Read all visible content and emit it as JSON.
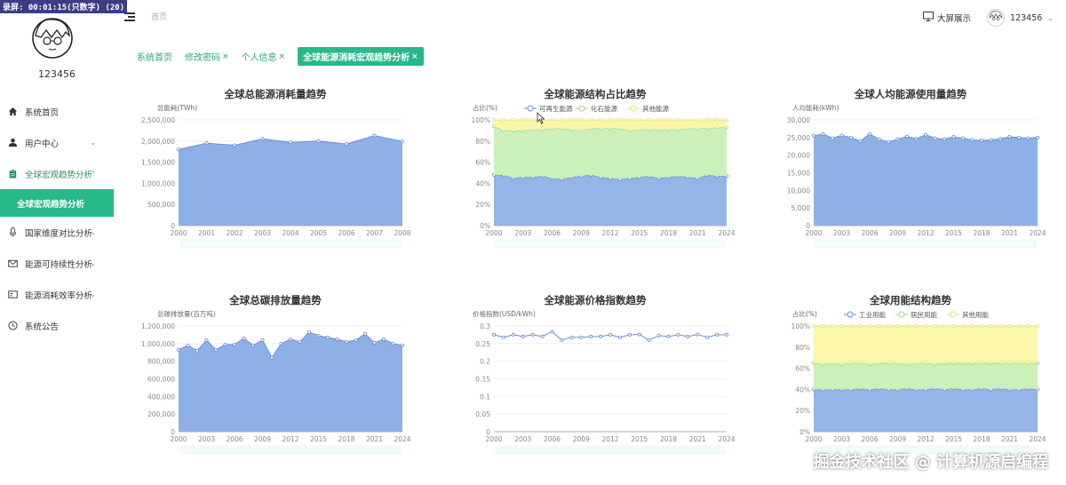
{
  "recorder_overlay": "录屏: 00:01:15(只数字) (20)",
  "user": {
    "name": "123456"
  },
  "sidebar": {
    "items": [
      {
        "label": "系统首页",
        "icon": "home-icon",
        "arrow": ""
      },
      {
        "label": "用户中心",
        "icon": "user-icon",
        "arrow": "⌄"
      },
      {
        "label": "全球宏观趋势分析",
        "icon": "clipboard-icon",
        "arrow": "^"
      },
      {
        "label": "国家维度对比分析",
        "icon": "microphone-icon",
        "arrow": "⌄"
      },
      {
        "label": "能源可持续性分析",
        "icon": "mail-icon",
        "arrow": "⌄"
      },
      {
        "label": "能源消耗效率分析",
        "icon": "card-icon",
        "arrow": "⌄"
      },
      {
        "label": "系统公告",
        "icon": "clock-icon",
        "arrow": ""
      }
    ],
    "active_sub": "全球宏观趋势分析"
  },
  "topbar": {
    "breadcrumb": "首页",
    "screen_label": "大屏展示",
    "user_name": "123456"
  },
  "tabs": [
    {
      "label": "系统首页",
      "close": ""
    },
    {
      "label": "修改密码",
      "close": "×"
    },
    {
      "label": "个人信息",
      "close": "×"
    },
    {
      "label": "全球能源消耗宏观趋势分析",
      "close": "×"
    }
  ],
  "colors": {
    "blue": "#8fb0e6",
    "blue_line": "#6c8ed6",
    "green": "#c9efb5",
    "yellow": "#fbf5a3",
    "accent": "#27b98a"
  },
  "chart_data": [
    {
      "type": "area",
      "title": "全球总能源消耗量趋势",
      "ylabel": "总能耗(TWh)",
      "x": [
        2000,
        2001,
        2002,
        2003,
        2004,
        2005,
        2006,
        2007,
        2008
      ],
      "xticks": [
        "2000",
        "2001",
        "2002",
        "2003",
        "2004",
        "2005",
        "2006",
        "2007",
        "2008"
      ],
      "ylim": [
        0,
        2500000
      ],
      "yticks": [
        "0",
        "500,000",
        "1,000,000",
        "1,500,000",
        "2,000,000",
        "2,500,000"
      ],
      "series": [
        {
          "values": [
            1800000,
            1950000,
            1900000,
            2050000,
            1970000,
            2000000,
            1930000,
            2130000,
            1990000
          ]
        }
      ]
    },
    {
      "type": "area",
      "stacked_percent": true,
      "title": "全球能源结构占比趋势",
      "ylabel": "占比(%)",
      "x": [
        2000,
        2001,
        2002,
        2003,
        2004,
        2005,
        2006,
        2007,
        2008,
        2009,
        2010,
        2011,
        2012,
        2013,
        2014,
        2015,
        2016,
        2017,
        2018,
        2019,
        2020,
        2021,
        2022,
        2023,
        2024
      ],
      "xticks": [
        "2000",
        "2003",
        "2006",
        "2009",
        "2012",
        "2015",
        "2018",
        "2021",
        "2024"
      ],
      "ylim": [
        0,
        100
      ],
      "yticks": [
        "0%",
        "20%",
        "40%",
        "60%",
        "80%",
        "100%"
      ],
      "series": [
        {
          "name": "可再生能源",
          "values": [
            48,
            48,
            45,
            46,
            46,
            47,
            45,
            44,
            46,
            47,
            48,
            46,
            45,
            44,
            45,
            46,
            47,
            45,
            46,
            47,
            46,
            45,
            48,
            47,
            47
          ]
        },
        {
          "name": "化石能源",
          "values": [
            46,
            42,
            45,
            44,
            45,
            44,
            47,
            48,
            45,
            43,
            44,
            46,
            47,
            48,
            45,
            45,
            44,
            46,
            45,
            44,
            46,
            47,
            44,
            46,
            46
          ]
        },
        {
          "name": "其他能源",
          "values": [
            6,
            10,
            10,
            10,
            9,
            9,
            8,
            8,
            9,
            10,
            8,
            8,
            8,
            8,
            10,
            9,
            9,
            9,
            9,
            9,
            8,
            8,
            8,
            7,
            7
          ]
        }
      ]
    },
    {
      "type": "area",
      "title": "全球人均能源使用量趋势",
      "ylabel": "人均能耗(kWh)",
      "x": [
        2000,
        2001,
        2002,
        2003,
        2004,
        2005,
        2006,
        2007,
        2008,
        2009,
        2010,
        2011,
        2012,
        2013,
        2014,
        2015,
        2016,
        2017,
        2018,
        2019,
        2020,
        2021,
        2022,
        2023,
        2024
      ],
      "xticks": [
        "2000",
        "2003",
        "2006",
        "2009",
        "2012",
        "2015",
        "2018",
        "2021",
        "2024"
      ],
      "ylim": [
        0,
        30000
      ],
      "yticks": [
        "0",
        "5,000",
        "10,000",
        "15,000",
        "20,000",
        "25,000",
        "30,000"
      ],
      "series": [
        {
          "values": [
            25500,
            26000,
            24800,
            25600,
            25000,
            24000,
            26000,
            24500,
            23800,
            24500,
            25300,
            24600,
            25800,
            24800,
            24500,
            25200,
            24800,
            24300,
            24200,
            24300,
            24600,
            25200,
            25000,
            24800,
            25000
          ]
        }
      ]
    },
    {
      "type": "area",
      "title": "全球总碳排放量趋势",
      "ylabel": "总碳排放量(百万吨)",
      "x": [
        2000,
        2001,
        2002,
        2003,
        2004,
        2005,
        2006,
        2007,
        2008,
        2009,
        2010,
        2011,
        2012,
        2013,
        2014,
        2015,
        2016,
        2017,
        2018,
        2019,
        2020,
        2021,
        2022,
        2023,
        2024
      ],
      "xticks": [
        "2000",
        "2003",
        "2006",
        "2009",
        "2012",
        "2015",
        "2018",
        "2021",
        "2024"
      ],
      "ylim": [
        0,
        1200000
      ],
      "yticks": [
        "0",
        "200,000",
        "400,000",
        "600,000",
        "800,000",
        "1,000,000",
        "1,200,000"
      ],
      "series": [
        {
          "values": [
            930000,
            980000,
            920000,
            1040000,
            930000,
            990000,
            990000,
            1060000,
            980000,
            1040000,
            840000,
            1000000,
            1050000,
            1020000,
            1130000,
            1090000,
            1070000,
            1050000,
            1020000,
            1040000,
            1110000,
            1010000,
            1050000,
            1000000,
            980000
          ]
        }
      ]
    },
    {
      "type": "line",
      "title": "全球能源价格指数趋势",
      "ylabel": "价格指数(USD/kWh)",
      "x": [
        2000,
        2001,
        2002,
        2003,
        2004,
        2005,
        2006,
        2007,
        2008,
        2009,
        2010,
        2011,
        2012,
        2013,
        2014,
        2015,
        2016,
        2017,
        2018,
        2019,
        2020,
        2021,
        2022,
        2023,
        2024
      ],
      "xticks": [
        "2000",
        "2003",
        "2006",
        "2009",
        "2012",
        "2015",
        "2018",
        "2021",
        "2024"
      ],
      "ylim": [
        0,
        0.3
      ],
      "yticks": [
        "0",
        "0.05",
        "0.1",
        "0.15",
        "0.2",
        "0.25",
        "0.3"
      ],
      "series": [
        {
          "values": [
            0.275,
            0.268,
            0.275,
            0.27,
            0.275,
            0.27,
            0.284,
            0.26,
            0.268,
            0.268,
            0.27,
            0.27,
            0.275,
            0.268,
            0.275,
            0.276,
            0.26,
            0.273,
            0.27,
            0.275,
            0.27,
            0.276,
            0.268,
            0.275,
            0.275
          ]
        }
      ]
    },
    {
      "type": "area",
      "stacked_percent": true,
      "title": "全球用能结构趋势",
      "ylabel": "占比(%)",
      "x": [
        2000,
        2001,
        2002,
        2003,
        2004,
        2005,
        2006,
        2007,
        2008,
        2009,
        2010,
        2011,
        2012,
        2013,
        2014,
        2015,
        2016,
        2017,
        2018,
        2019,
        2020,
        2021,
        2022,
        2023,
        2024
      ],
      "xticks": [
        "2000",
        "2003",
        "2006",
        "2009",
        "2012",
        "2015",
        "2018",
        "2021",
        "2024"
      ],
      "ylim": [
        0,
        100
      ],
      "yticks": [
        "0%",
        "20%",
        "40%",
        "60%",
        "80%",
        "100%"
      ],
      "series": [
        {
          "name": "工业用能",
          "values": [
            40,
            40,
            40,
            40,
            40,
            41,
            40,
            41,
            40,
            40,
            41,
            40,
            40,
            41,
            40,
            41,
            40,
            40,
            41,
            40,
            41,
            40,
            40,
            41,
            40
          ]
        },
        {
          "name": "居民用能",
          "values": [
            25,
            24,
            25,
            24,
            25,
            24,
            24,
            24,
            25,
            25,
            23,
            25,
            25,
            23,
            25,
            24,
            25,
            25,
            24,
            25,
            24,
            25,
            25,
            24,
            25
          ]
        },
        {
          "name": "其他用能",
          "values": [
            35,
            36,
            35,
            36,
            35,
            35,
            36,
            35,
            35,
            35,
            36,
            35,
            35,
            36,
            35,
            35,
            35,
            35,
            35,
            35,
            35,
            35,
            35,
            35,
            35
          ]
        }
      ]
    }
  ],
  "watermark": "掘金技术社区 @ 计算机源启编程"
}
